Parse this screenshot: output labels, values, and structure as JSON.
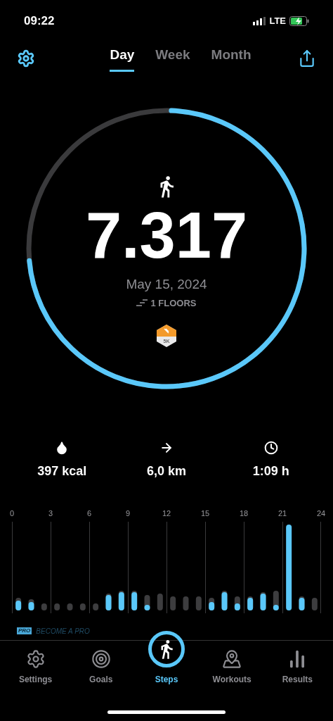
{
  "status_bar": {
    "time": "09:22",
    "network": "LTE"
  },
  "period_tabs": [
    {
      "label": "Day",
      "selected": true
    },
    {
      "label": "Week",
      "selected": false
    },
    {
      "label": "Month",
      "selected": false
    }
  ],
  "ring": {
    "level": 0.73,
    "steps": "7.317",
    "date": "May 15, 2024",
    "floors": "1 FLOORS",
    "badge_label": "5K"
  },
  "stats": [
    {
      "kind": "calories",
      "value": "397 kcal"
    },
    {
      "kind": "distance",
      "value": "6,0 km"
    },
    {
      "kind": "duration",
      "value": "1:09 h"
    }
  ],
  "hour_labels": [
    "0",
    "3",
    "6",
    "9",
    "12",
    "15",
    "18",
    "21",
    "24"
  ],
  "promo": {
    "badge": "PRO",
    "text": "BECOME A PRO"
  },
  "nav": [
    {
      "kind": "settings",
      "label": "Settings",
      "selected": false
    },
    {
      "kind": "goals",
      "label": "Goals",
      "selected": false
    },
    {
      "kind": "steps",
      "label": "Steps",
      "selected": true
    },
    {
      "kind": "workouts",
      "label": "Workouts",
      "selected": false
    },
    {
      "kind": "results",
      "label": "Results",
      "selected": false
    }
  ]
}
